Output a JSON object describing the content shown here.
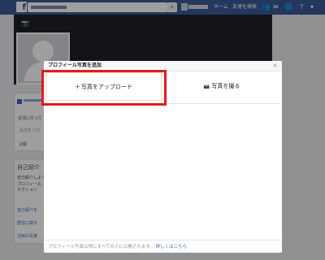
{
  "topbar": {
    "logo": "f",
    "nav_home": "ホーム",
    "nav_find_friends": "友達を検索"
  },
  "modal": {
    "title": "プロフィール写真を追加",
    "close": "×",
    "upload_label": "写真をアップロード",
    "take_photo_label": "写真を撮る",
    "footer_text": "プロフィール写真は常にすべての人に公開されます。",
    "footer_link": "詳しくはこちら"
  },
  "sidebar": {
    "intro_title": "自己紹介",
    "intro_prompt": "自己紹介しよう",
    "intro_text_1": "プロフィール",
    "intro_text_2": "セクション",
    "status_prompt": "近況に行って",
    "input_placeholder": "近況を入力",
    "privacy": "公開",
    "item_1": "自己紹介を",
    "item_2": "居住に関す",
    "item_3": "注目の写真"
  },
  "colors": {
    "brand": "#3b5998",
    "highlight": "#e31b23"
  }
}
